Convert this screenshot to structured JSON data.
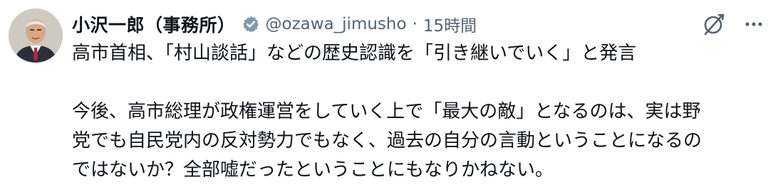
{
  "post": {
    "author_name": "小沢一郎（事務所）",
    "handle": "@ozawa_jimusho",
    "separator": "·",
    "time": "15時間",
    "title_line": "高市首相、「村山談話」などの歴史認識を「引き継いでいく」と発言",
    "body_lines": [
      "今後、高市総理が政権運営をしていく上で「最大の敵」となるのは、実は野",
      "党でも自民党内の反対勢力でもなく、過去の自分の言動ということになるの",
      "ではないか？全部嘘だったということにもなりかねない。"
    ]
  },
  "icons": {
    "avatar": "avatar-photo",
    "badge": "verified-badge-icon",
    "grok": "grok-icon",
    "more": "more-options-icon"
  },
  "colors": {
    "text": "#0f1419",
    "secondary": "#536471",
    "badge": "#829aab",
    "background": "#ffffff"
  }
}
